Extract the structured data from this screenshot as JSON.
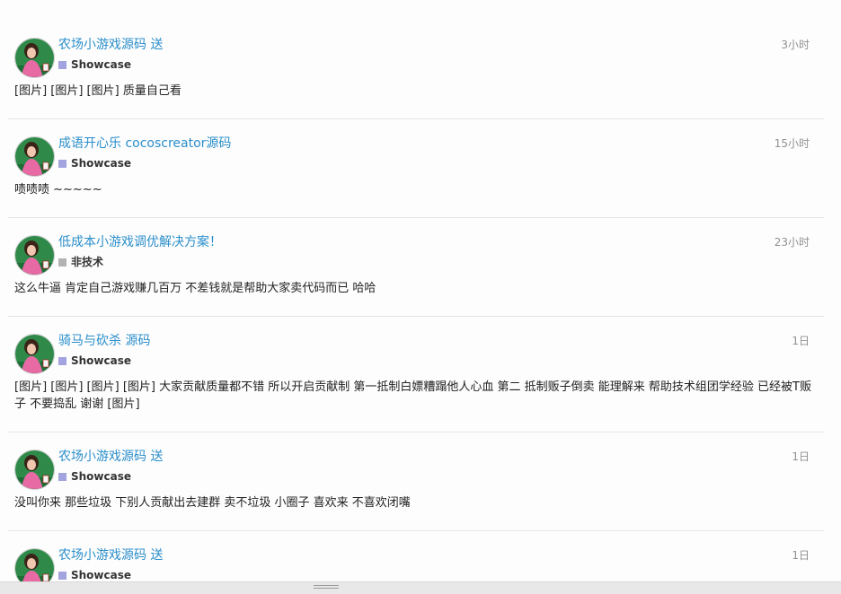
{
  "posts": [
    {
      "title": "农场小游戏源码 送",
      "category": "Showcase",
      "category_color": "#a3a3df",
      "time": "3小时",
      "excerpt": "[图片] [图片] [图片] 质量自己看"
    },
    {
      "title": "成语开心乐 cocoscreator源码",
      "category": "Showcase",
      "category_color": "#a3a3df",
      "time": "15小时",
      "excerpt": "啧啧啧 ~~~~~"
    },
    {
      "title": "低成本小游戏调优解决方案！",
      "category": "非技术",
      "category_color": "#b3b3b3",
      "time": "23小时",
      "excerpt": "这么牛逼 肯定自己游戏赚几百万 不差钱就是帮助大家卖代码而已 哈哈"
    },
    {
      "title": "骑马与砍杀 源码",
      "category": "Showcase",
      "category_color": "#a3a3df",
      "time": "1日",
      "excerpt": "[图片] [图片] [图片] [图片] 大家贡献质量都不错 所以开启贡献制 第一抵制白嫖糟蹋他人心血 第二 抵制贩子倒卖 能理解来 帮助技术组团学经验 已经被T贩子 不要捣乱 谢谢 [图片]"
    },
    {
      "title": "农场小游戏源码 送",
      "category": "Showcase",
      "category_color": "#a3a3df",
      "time": "1日",
      "excerpt": "没叫你来 那些垃圾 下别人贡献出去建群 卖不垃圾 小圈子 喜欢来 不喜欢闭嘴"
    },
    {
      "title": "农场小游戏源码 送",
      "category": "Showcase",
      "category_color": "#a3a3df",
      "time": "1日",
      "excerpt": ""
    }
  ]
}
